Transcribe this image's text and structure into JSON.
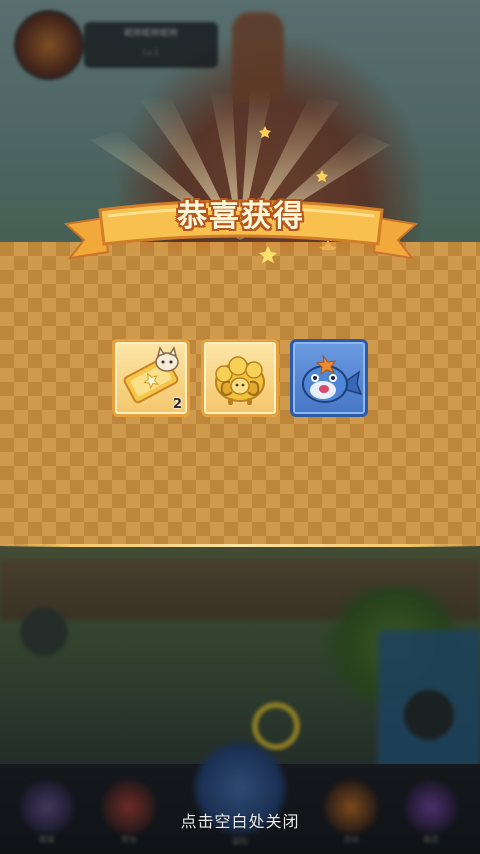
{
  "player": {
    "name": "昵称昵称昵称",
    "level": "Lv.1"
  },
  "reward_popup": {
    "title": "恭喜获得",
    "items": [
      {
        "name": "ticket",
        "count": "2"
      },
      {
        "name": "golden-sheep",
        "count": ""
      },
      {
        "name": "blue-fish",
        "count": ""
      }
    ],
    "close_hint": "点击空白处关闭"
  },
  "bottom_nav": [
    {
      "label": "图鉴"
    },
    {
      "label": "背包"
    },
    {
      "label": "冒险"
    },
    {
      "label": "活动"
    },
    {
      "label": "商店"
    }
  ],
  "colors": {
    "banner_gold": "#f4b547",
    "panel_orange": "#e09434",
    "item_gold_border": "#e6a13c",
    "item_blue_border": "#2f5aa6"
  }
}
